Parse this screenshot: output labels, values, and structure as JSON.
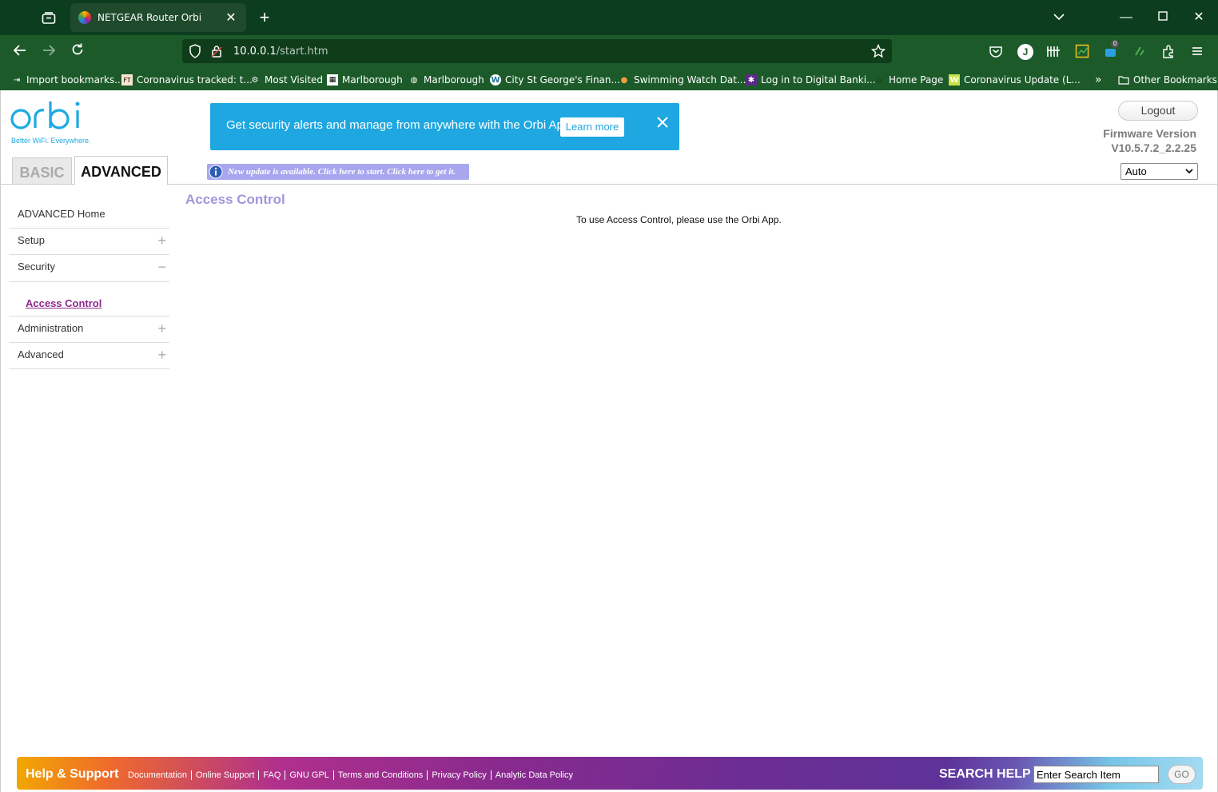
{
  "browser": {
    "tab_title": "NETGEAR Router Orbi",
    "url_host": "10.0.0.1",
    "url_path": "/start.htm",
    "bookmarks": [
      {
        "label": "Import bookmarks...",
        "icon": "import-icon"
      },
      {
        "label": "Coronavirus tracked: t...",
        "icon": "ft-icon"
      },
      {
        "label": "Most Visited",
        "icon": "gear-icon"
      },
      {
        "label": "Marlborough",
        "icon": "calendar-icon"
      },
      {
        "label": "Marlborough",
        "icon": "globe-icon"
      },
      {
        "label": "City St George's Finan...",
        "icon": "wordpress-icon"
      },
      {
        "label": "Swimming Watch Dat...",
        "icon": "pin-icon"
      },
      {
        "label": "Log in to Digital Banki...",
        "icon": "bank-icon"
      },
      {
        "label": "Home Page",
        "icon": "home-icon"
      },
      {
        "label": "Coronavirus Update (L...",
        "icon": "w-icon"
      }
    ],
    "other_bookmarks": "Other Bookmarks",
    "profile_initial": "J",
    "ext_badge": "0"
  },
  "header": {
    "logo_tagline": "Better WiFi. Everywhere.",
    "promo_text": "Get security alerts and manage from anywhere with the Orbi App.",
    "learn_more": "Learn more",
    "logout": "Logout",
    "firmware_label": "Firmware Version",
    "firmware_version": "V10.5.7.2_2.2.25",
    "tab_basic": "BASIC",
    "tab_advanced": "ADVANCED",
    "update_notice": "New update is available. Click here to start. Click here to get it.",
    "mode_selected": "Auto"
  },
  "sidebar": {
    "items": [
      {
        "label": "ADVANCED Home",
        "toggle": ""
      },
      {
        "label": "Setup",
        "toggle": "+"
      },
      {
        "label": "Security",
        "toggle": "−"
      },
      {
        "label": "Access Control",
        "toggle": ""
      },
      {
        "label": "Administration",
        "toggle": "+"
      },
      {
        "label": "Advanced",
        "toggle": "+"
      }
    ]
  },
  "content": {
    "title": "Access Control",
    "message": "To use Access Control, please use the Orbi App."
  },
  "footer": {
    "help_title": "Help & Support",
    "links": [
      "Documentation",
      "Online Support",
      "FAQ",
      "GNU GPL",
      "Terms and Conditions",
      "Privacy Policy",
      "Analytic Data Policy"
    ],
    "search_label": "SEARCH HELP",
    "search_placeholder": "Enter Search Item",
    "go": "GO"
  },
  "colors": {
    "browser_frame": "#0b3d1e",
    "browser_toolbar": "#1c5a2a",
    "promo_blue": "#1ea7e1",
    "content_title": "#a394dd",
    "sidebar_active": "#8e2a8e"
  }
}
